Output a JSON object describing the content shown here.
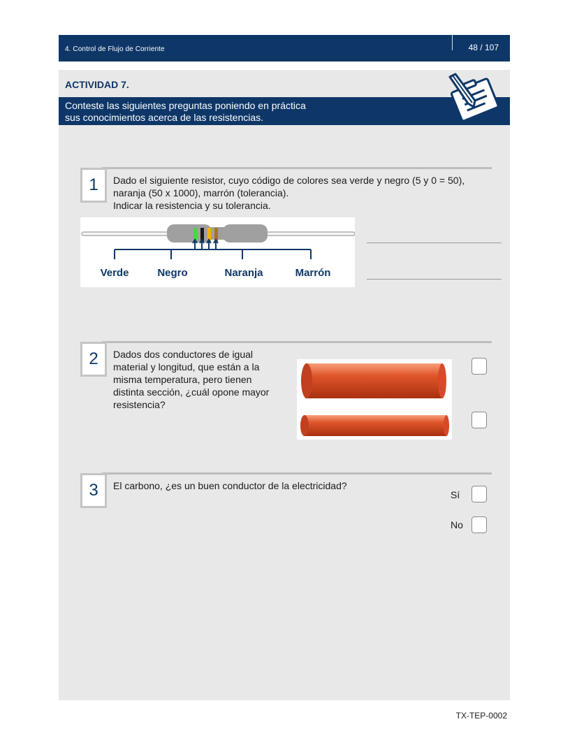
{
  "header": {
    "section": "4. Control de Flujo de Corriente",
    "pages": "48 / 107"
  },
  "activity": {
    "title": "ACTIVIDAD 7.",
    "instructions_line1": "Conteste las siguientes preguntas poniendo en práctica",
    "instructions_line2": "sus conocimientos acerca de las resistencias.",
    "icon": "checklist-pencil-icon"
  },
  "questions": [
    {
      "number": "1",
      "lines": [
        "Dado el siguiente resistor, cuyo código de colores sea verde y negro (5 y 0 = 50),",
        "naranja (50 x 1000), marrón (tolerancia).",
        "Indicar la resistencia y su tolerancia."
      ],
      "bands": [
        "Verde",
        "Negro",
        "Naranja",
        "Marrón"
      ],
      "band_colors": [
        "#3fdc3a",
        "#1a1a1a",
        "#f0b400",
        "#a5742a"
      ]
    },
    {
      "number": "2",
      "lines": [
        "Dados dos conductores de igual",
        "material y longitud, que están a la",
        "misma temperatura, pero tienen",
        "distinta sección, ¿cuál opone mayor",
        "resistencia?"
      ]
    },
    {
      "number": "3",
      "lines": [
        "El carbono, ¿es un buen conductor de la electricidad?"
      ],
      "options": [
        "Sí",
        "No"
      ]
    }
  ],
  "footer": {
    "code": "TX-TEP-0002"
  },
  "colors": {
    "brand_blue": "#0e3768",
    "panel_gray": "#e8e8e8",
    "wire_copper": "#e0552b"
  }
}
